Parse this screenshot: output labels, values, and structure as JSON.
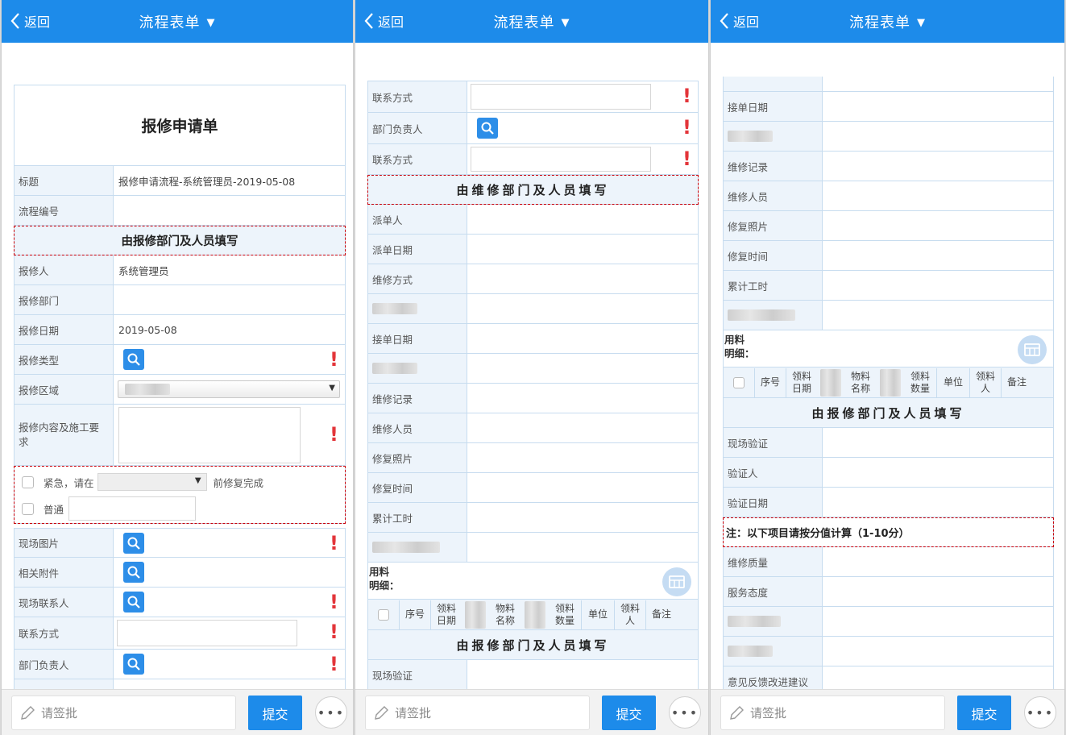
{
  "nav": {
    "back": "返回",
    "title": "流程表单"
  },
  "footer": {
    "sign_placeholder": "请签批",
    "submit": "提交"
  },
  "p1": {
    "form_title": "报修申请单",
    "title_label": "标题",
    "title_value": "报修申请流程-系统管理员-2019-05-08",
    "flow_no_label": "流程编号",
    "section_report": "由报修部门及人员填写",
    "reporter_label": "报修人",
    "reporter_value": "系统管理员",
    "dept_label": "报修部门",
    "date_label": "报修日期",
    "date_value": "2019-05-08",
    "type_label": "报修类型",
    "area_label": "报修区域",
    "content_label": "报修内容及施工要求",
    "urgent_text": "紧急，请在",
    "urgent_after": "前修复完成",
    "normal_text": "普通",
    "photo_label": "现场图片",
    "attach_label": "相关附件",
    "contact_label": "现场联系人",
    "phone_label": "联系方式",
    "manager_label": "部门负责人"
  },
  "p2": {
    "phone_label": "联系方式",
    "manager_label": "部门负责人",
    "phone2_label": "联系方式",
    "section_repair": "由维修部门及人员填写",
    "dispatcher_label": "派单人",
    "dispatch_date_label": "派单日期",
    "method_label": "维修方式",
    "accept_date_label": "接单日期",
    "record_label": "维修记录",
    "staff_label": "维修人员",
    "photo_label": "修复照片",
    "time_label": "修复时间",
    "hours_label": "累计工时",
    "material_label_1": "用料",
    "material_label_2": "明细：",
    "col_no": "序号",
    "col_date_1": "领料",
    "col_date_2": "日期",
    "col_name_1": "物料",
    "col_name_2": "名称",
    "col_qty_1": "领料",
    "col_qty_2": "数量",
    "col_unit": "单位",
    "col_person_1": "领料",
    "col_person_2": "人",
    "col_note": "备注",
    "section_verify": "由报修部门及人员填写",
    "verify_label": "现场验证"
  },
  "p3": {
    "accept_date_label": "接单日期",
    "record_label": "维修记录",
    "staff_label": "维修人员",
    "photo_label": "修复照片",
    "time_label": "修复时间",
    "hours_label": "累计工时",
    "section_verify": "由报修部门及人员填写",
    "verify_label": "现场验证",
    "verifier_label": "验证人",
    "verify_date_label": "验证日期",
    "note": "注：以下项目请按分值计算（1-10分）",
    "quality_label": "维修质量",
    "service_label": "服务态度",
    "feedback_label": "意见反馈改进建议"
  },
  "colors": {
    "nav_blue": "#1d8bea",
    "label_bg": "#edf4fb",
    "required_red": "#e3353a",
    "dash_red": "#c9000a"
  }
}
